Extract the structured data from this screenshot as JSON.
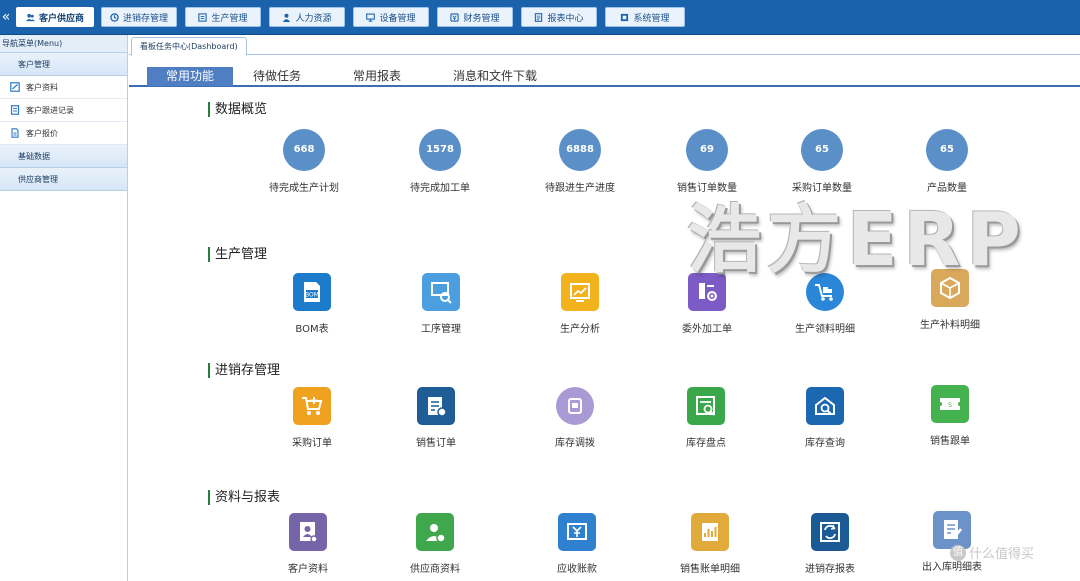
{
  "topnav": {
    "collapse_glyph": "«",
    "items": [
      {
        "label": "客户供应商",
        "icon": "users-icon",
        "active": true
      },
      {
        "label": "进销存管理",
        "icon": "cycle-icon"
      },
      {
        "label": "生产管理",
        "icon": "factory-icon"
      },
      {
        "label": "人力资源",
        "icon": "person-icon"
      },
      {
        "label": "设备管理",
        "icon": "monitor-icon"
      },
      {
        "label": "财务管理",
        "icon": "finance-icon"
      },
      {
        "label": "报表中心",
        "icon": "report-icon"
      },
      {
        "label": "系统管理",
        "icon": "system-icon"
      }
    ]
  },
  "sidebar": {
    "title": "导航菜单(Menu)",
    "groups": [
      {
        "label": "客户管理",
        "items": [
          {
            "label": "客户资料",
            "icon": "customer-card-icon"
          },
          {
            "label": "客户跟进记录",
            "icon": "follow-record-icon"
          },
          {
            "label": "客户报价",
            "icon": "quote-doc-icon"
          }
        ]
      },
      {
        "label": "基础数据",
        "items": []
      },
      {
        "label": "供应商管理",
        "items": []
      }
    ]
  },
  "main": {
    "tab_label": "看板任务中心(Dashboard)",
    "subtabs": [
      "常用功能",
      "待做任务",
      "常用报表",
      "消息和文件下载"
    ],
    "overview": {
      "title": "数据概览",
      "stats": [
        {
          "value": "668",
          "label": "待完成生产计划"
        },
        {
          "value": "1578",
          "label": "待完成加工单"
        },
        {
          "value": "6888",
          "label": "待跟进生产进度"
        },
        {
          "value": "69",
          "label": "销售订单数量"
        },
        {
          "value": "65",
          "label": "采购订单数量"
        },
        {
          "value": "65",
          "label": "产品数量"
        }
      ]
    },
    "production": {
      "title": "生产管理",
      "items": [
        {
          "label": "BOM表",
          "icon": "bom-icon",
          "color": "#1d7bcc"
        },
        {
          "label": "工序管理",
          "icon": "process-icon",
          "color": "#4b9fde"
        },
        {
          "label": "生产分析",
          "icon": "analysis-icon",
          "color": "#f2b21c"
        },
        {
          "label": "委外加工单",
          "icon": "outsource-icon",
          "color": "#7d5bc6"
        },
        {
          "label": "生产领料明细",
          "icon": "material-pick-icon",
          "color": "#2a86d6"
        },
        {
          "label": "生产补料明细",
          "icon": "material-supply-icon",
          "color": "#d9a85a"
        }
      ]
    },
    "inventory": {
      "title": "进销存管理",
      "items": [
        {
          "label": "采购订单",
          "icon": "purchase-cart-icon",
          "color": "#efa21f"
        },
        {
          "label": "销售订单",
          "icon": "sales-order-icon",
          "color": "#1e5d96"
        },
        {
          "label": "库存调拨",
          "icon": "transfer-icon",
          "color": "#a99ad6"
        },
        {
          "label": "库存盘点",
          "icon": "stocktake-icon",
          "color": "#3aa84a"
        },
        {
          "label": "库存查询",
          "icon": "stock-query-icon",
          "color": "#1c68b0"
        },
        {
          "label": "销售跟单",
          "icon": "sales-follow-icon",
          "color": "#43b24f"
        }
      ]
    },
    "reports": {
      "title": "资料与报表",
      "items": [
        {
          "label": "客户资料",
          "icon": "customer-info-icon",
          "color": "#7565a8"
        },
        {
          "label": "供应商资料",
          "icon": "supplier-info-icon",
          "color": "#3fa84c"
        },
        {
          "label": "应收账款",
          "icon": "receivable-icon",
          "color": "#2f80cf"
        },
        {
          "label": "销售账单明细",
          "icon": "sales-bill-icon",
          "color": "#e2aa3a"
        },
        {
          "label": "进销存报表",
          "icon": "inventory-report-icon",
          "color": "#1b5a94"
        },
        {
          "label": "出入库明细表",
          "icon": "io-detail-icon",
          "color": "#6b93c9"
        }
      ]
    }
  },
  "watermark": {
    "text": "浩方ERP",
    "corner": "什么值得买",
    "corner_badge": "值"
  }
}
